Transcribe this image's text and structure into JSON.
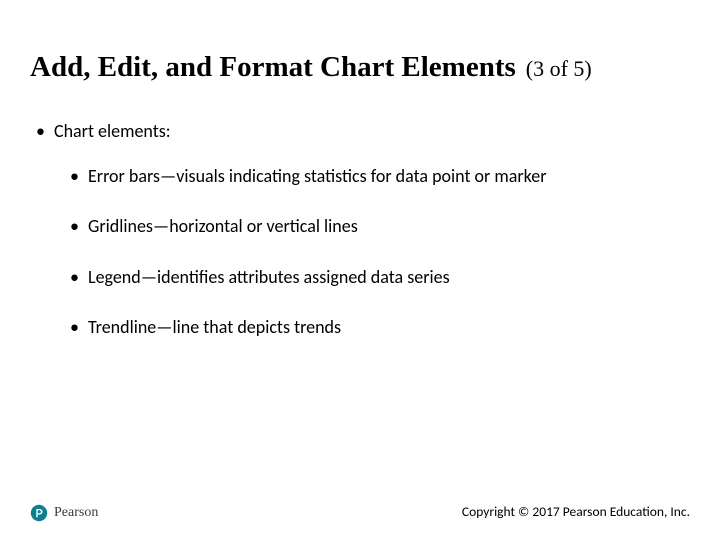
{
  "title": {
    "main": "Add, Edit, and Format Chart Elements",
    "counter": "(3 of 5)"
  },
  "bullets": {
    "l1": "Chart elements:",
    "l2": [
      "Error bars—visuals indicating statistics for data point or marker",
      "Gridlines—horizontal or vertical lines",
      "Legend—identifies attributes assigned data series",
      "Trendline—line that depicts trends"
    ]
  },
  "footer": {
    "brand": "Pearson",
    "copyright": "Copyright © 2017 Pearson Education, Inc."
  },
  "brand_color": "#0f7f8f"
}
